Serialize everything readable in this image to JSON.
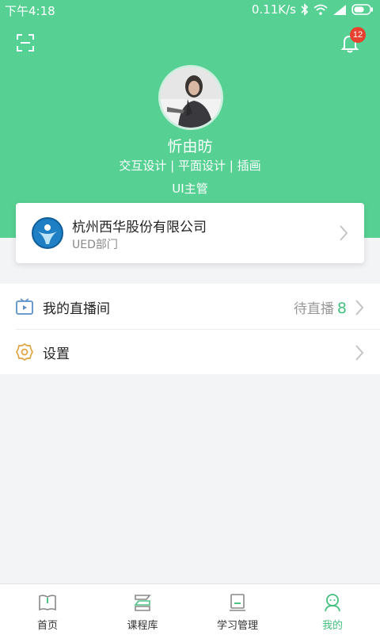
{
  "statusbar": {
    "time": "下午4:18",
    "speed": "0.11K/s"
  },
  "header": {
    "notification_count": "12"
  },
  "profile": {
    "name": "忻由昉",
    "tags": "交互设计 | 平面设计 | 插画",
    "title": "UI主管"
  },
  "company": {
    "name": "杭州西华股份有限公司",
    "department": "UED部门"
  },
  "menu": {
    "live_room": {
      "label": "我的直播间",
      "status_label": "待直播",
      "count": "8"
    },
    "settings": {
      "label": "设置"
    }
  },
  "tabbar": {
    "items": [
      {
        "label": "首页"
      },
      {
        "label": "课程库"
      },
      {
        "label": "学习管理"
      },
      {
        "label": "我的"
      }
    ]
  },
  "colors": {
    "brand_green": "#57d193",
    "accent_green": "#43c07e",
    "badge_red": "#e8412f"
  }
}
